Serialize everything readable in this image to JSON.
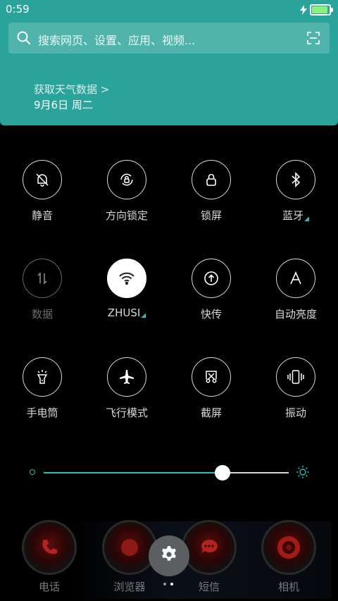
{
  "status": {
    "time": "0:59",
    "battery_percent": 0.85
  },
  "search": {
    "placeholder": "搜索网页、设置、应用、视频..."
  },
  "weather": {
    "title": "获取天气数据 >",
    "date": "9月6日 周二"
  },
  "toggles": [
    {
      "label": "静音",
      "icon": "bell-off-icon",
      "state": "off"
    },
    {
      "label": "方向锁定",
      "icon": "rotation-lock-icon",
      "state": "off"
    },
    {
      "label": "锁屏",
      "icon": "lock-icon",
      "state": "off"
    },
    {
      "label": "蓝牙",
      "icon": "bluetooth-icon",
      "state": "off",
      "has_more": true
    },
    {
      "label": "数据",
      "icon": "mobile-data-icon",
      "state": "disabled"
    },
    {
      "label": "ZHUSI",
      "icon": "wifi-icon",
      "state": "on",
      "has_more": true
    },
    {
      "label": "快传",
      "icon": "share-upload-icon",
      "state": "off"
    },
    {
      "label": "自动亮度",
      "icon": "auto-brightness-icon",
      "state": "off"
    },
    {
      "label": "手电筒",
      "icon": "flashlight-icon",
      "state": "off"
    },
    {
      "label": "飞行模式",
      "icon": "airplane-icon",
      "state": "off"
    },
    {
      "label": "截屏",
      "icon": "screenshot-icon",
      "state": "off"
    },
    {
      "label": "振动",
      "icon": "vibrate-icon",
      "state": "off"
    }
  ],
  "brightness": {
    "level": 0.73
  },
  "dock": [
    {
      "label": "电话",
      "icon": "phone-icon"
    },
    {
      "label": "浏览器",
      "icon": "browser-icon"
    },
    {
      "label": "短信",
      "icon": "message-icon"
    },
    {
      "label": "相机",
      "icon": "camera-icon"
    }
  ],
  "page_indicator": {
    "count": 2,
    "active": 1
  },
  "colors": {
    "header": "#2aa49a",
    "accent": "#2fbfb3"
  }
}
